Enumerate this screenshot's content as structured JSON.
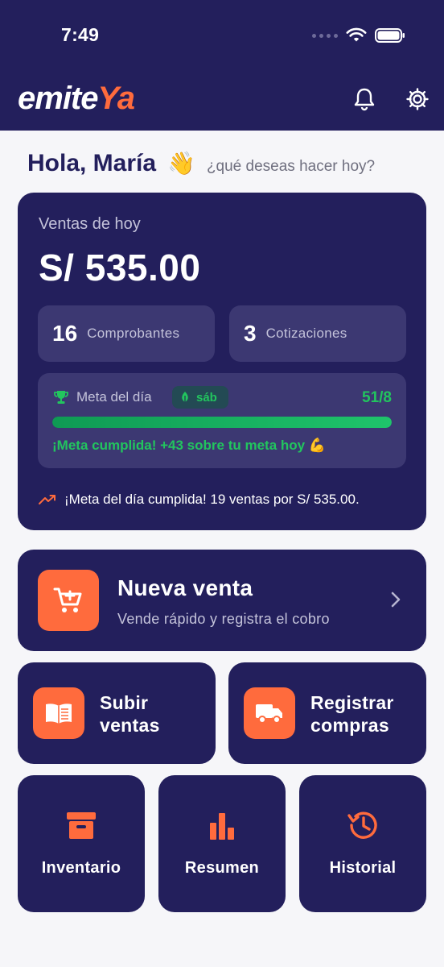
{
  "status_bar": {
    "time": "7:49"
  },
  "header": {
    "logo_main": "emite",
    "logo_accent": "Ya"
  },
  "greeting": {
    "title": "Hola, María",
    "emoji": "👋",
    "subtitle": "¿qué deseas hacer hoy?"
  },
  "sales_card": {
    "label": "Ventas de hoy",
    "amount": "S/ 535.00",
    "stats": [
      {
        "value": "16",
        "label": "Comprobantes"
      },
      {
        "value": "3",
        "label": "Cotizaciones"
      }
    ],
    "goal": {
      "title": "Meta del día",
      "badge": "sáb",
      "count": "51/8",
      "progress": 1.0,
      "message": "¡Meta cumplida! +43 sobre tu meta hoy 💪"
    },
    "note": "¡Meta del día cumplida! 19 ventas por S/ 535.00."
  },
  "new_sale": {
    "title": "Nueva venta",
    "subtitle": "Vende rápido y registra el cobro"
  },
  "actions": [
    {
      "title": "Subir\nventas",
      "icon": "book-icon"
    },
    {
      "title": "Registrar\ncompras",
      "icon": "truck-icon"
    }
  ],
  "tiles": [
    {
      "label": "Inventario",
      "icon": "archive-box-icon"
    },
    {
      "label": "Resumen",
      "icon": "bar-chart-icon"
    },
    {
      "label": "Historial",
      "icon": "history-icon"
    }
  ],
  "colors": {
    "navy": "#231f5c",
    "orange": "#ff6b3d",
    "green": "#22c55e",
    "background": "#f6f6f9"
  }
}
